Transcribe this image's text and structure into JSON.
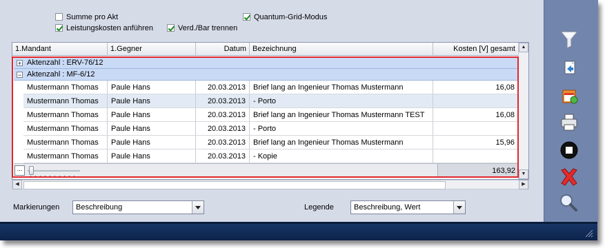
{
  "options": {
    "summe_pro_akt": {
      "label": "Summe pro Akt",
      "checked": false
    },
    "leistungskosten": {
      "label": "Leistungskosten anführen",
      "checked": true
    },
    "quantum_grid": {
      "label": "Quantum-Grid-Modus",
      "checked": true
    },
    "verd_bar": {
      "label": "Verd./Bar trennen",
      "checked": true
    }
  },
  "grid": {
    "columns": [
      "1.Mandant",
      "1.Gegner",
      "Datum",
      "Bezeichnung",
      "Kosten [V] gesamt"
    ],
    "groups": [
      {
        "expander": "+",
        "label": "Aktenzahl : ERV-76/12"
      },
      {
        "expander": "−",
        "label": "Aktenzahl : MF-6/12"
      }
    ],
    "rows": [
      {
        "mandant": "Mustermann Thomas",
        "gegner": "Paule Hans",
        "datum": "20.03.2013",
        "bezeichnung": "Brief lang an Ingenieur Thomas Mustermann",
        "kosten": "16,08"
      },
      {
        "mandant": "Mustermann Thomas",
        "gegner": "Paule Hans",
        "datum": "20.03.2013",
        "bezeichnung": "- Porto",
        "kosten": ""
      },
      {
        "mandant": "Mustermann Thomas",
        "gegner": "Paule Hans",
        "datum": "20.03.2013",
        "bezeichnung": "Brief lang an Ingenieur Thomas Mustermann TEST",
        "kosten": "16,08"
      },
      {
        "mandant": "Mustermann Thomas",
        "gegner": "Paule Hans",
        "datum": "20.03.2013",
        "bezeichnung": "- Porto",
        "kosten": ""
      },
      {
        "mandant": "Mustermann Thomas",
        "gegner": "Paule Hans",
        "datum": "20.03.2013",
        "bezeichnung": "Brief lang an Ingenieur Thomas Mustermann",
        "kosten": "15,96"
      },
      {
        "mandant": "Mustermann Thomas",
        "gegner": "Paule Hans",
        "datum": "20.03.2013",
        "bezeichnung": "- Kopie",
        "kosten": ""
      }
    ],
    "footer": {
      "button": "...",
      "sum": "163,92"
    }
  },
  "bottom": {
    "markierungen_label": "Markierungen",
    "markierungen_value": "Beschreibung",
    "legende_label": "Legende",
    "legende_value": "Beschreibung, Wert"
  },
  "toolbar_icons": [
    "filter-icon",
    "export-icon",
    "calendar-edit-icon",
    "printer-icon",
    "stop-icon",
    "close-icon",
    "search-icon"
  ],
  "colors": {
    "highlight_border": "#e0262b",
    "group_bg": "#c9daf5",
    "toolbar_bg": "#7285ad",
    "statusbar_bg": "#173566"
  }
}
